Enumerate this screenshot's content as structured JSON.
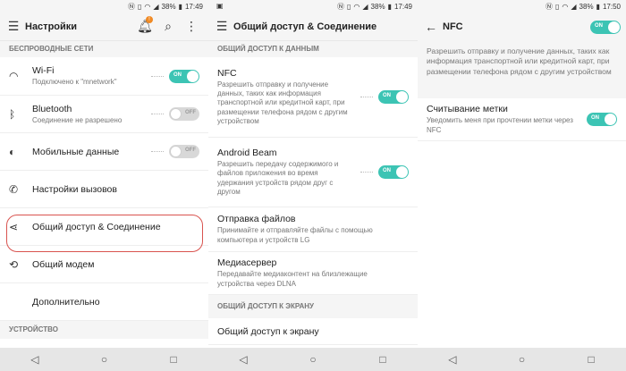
{
  "status": {
    "time": "17:49",
    "time3": "17:50",
    "battery": "38%",
    "icons": [
      "notification-n-icon",
      "vibrate-icon",
      "wifi-icon",
      "signal-icon",
      "battery-icon"
    ]
  },
  "panel1": {
    "title": "Настройки",
    "badge": "!",
    "section_wireless": "БЕСПРОВОДНЫЕ СЕТИ",
    "items": [
      {
        "title": "Wi-Fi",
        "subtitle": "Подключено к \"mnetwork\"",
        "toggle": "ON"
      },
      {
        "title": "Bluetooth",
        "subtitle": "Соединение не разрешено",
        "toggle": "OFF"
      },
      {
        "title": "Мобильные данные",
        "toggle": "OFF"
      },
      {
        "title": "Настройки вызовов"
      },
      {
        "title": "Общий доступ & Соединение"
      },
      {
        "title": "Общий модем"
      },
      {
        "title": "Дополнительно"
      }
    ],
    "section_device": "УСТРОЙСТВО"
  },
  "panel2": {
    "title": "Общий доступ & Соединение",
    "section_data": "ОБЩИЙ ДОСТУП К ДАННЫМ",
    "items": [
      {
        "title": "NFC",
        "subtitle": "Разрешить отправку и получение данных, таких как информация транспортной или кредитной карт, при размещении телефона рядом с другим устройством",
        "toggle": "ON"
      },
      {
        "title": "Android Beam",
        "subtitle": "Разрешить передачу содержимого и файлов приложения во время удержания устройств рядом друг с другом",
        "toggle": "ON"
      },
      {
        "title": "Отправка файлов",
        "subtitle": "Принимайте и отправляйте файлы с помощью компьютера и устройств LG"
      },
      {
        "title": "Медиасервер",
        "subtitle": "Передавайте медиаконтент на близлежащие устройства через DLNA"
      }
    ],
    "section_screen": "ОБЩИЙ ДОСТУП К ЭКРАНУ",
    "screen_item": "Общий доступ к экрану"
  },
  "panel3": {
    "title": "NFC",
    "toggle": "ON",
    "info": "Разрешить отправку и получение данных, таких как информация транспортной или кредитной карт, при размещении телефона рядом с другим устройством",
    "item": {
      "title": "Считывание метки",
      "subtitle": "Уведомить меня при прочтении метки через NFC",
      "toggle": "ON"
    }
  },
  "colors": {
    "accent": "#3cc4b4",
    "highlight": "#d9534f",
    "background": "#f5f5f5"
  }
}
